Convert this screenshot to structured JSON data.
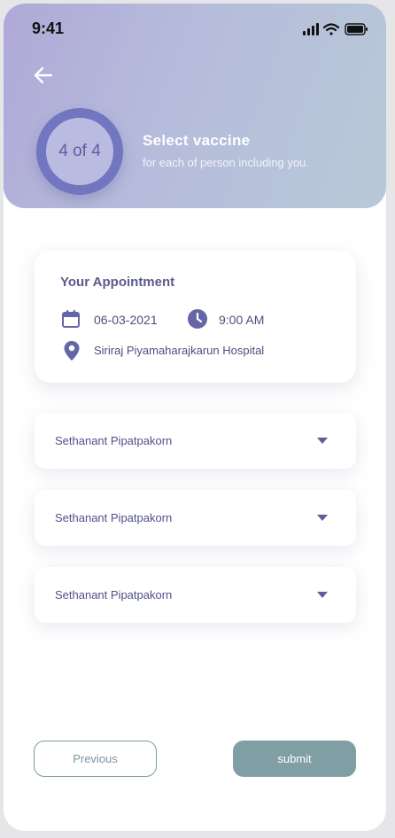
{
  "status_bar": {
    "time": "9:41"
  },
  "header": {
    "step": "4 of 4",
    "title": "Select vaccine",
    "subtitle": "for each of person including you."
  },
  "appointment": {
    "title": "Your Appointment",
    "date": "06-03-2021",
    "time": "9:00 AM",
    "hospital": "Siriraj Piyamaharajkarun Hospital"
  },
  "selects": [
    {
      "value": "Sethanant Pipatpakorn"
    },
    {
      "value": "Sethanant Pipatpakorn"
    },
    {
      "value": "Sethanant Pipatpakorn"
    }
  ],
  "buttons": {
    "previous": "Previous",
    "submit": "submit"
  },
  "colors": {
    "accent": "#7275c0",
    "text_primary": "#5b5a8d",
    "button_secondary": "#7f9fa5"
  },
  "icons": [
    "back-arrow-icon",
    "calendar-icon",
    "clock-icon",
    "location-pin-icon",
    "chevron-down-icon",
    "signal-icon",
    "wifi-icon",
    "battery-icon"
  ]
}
